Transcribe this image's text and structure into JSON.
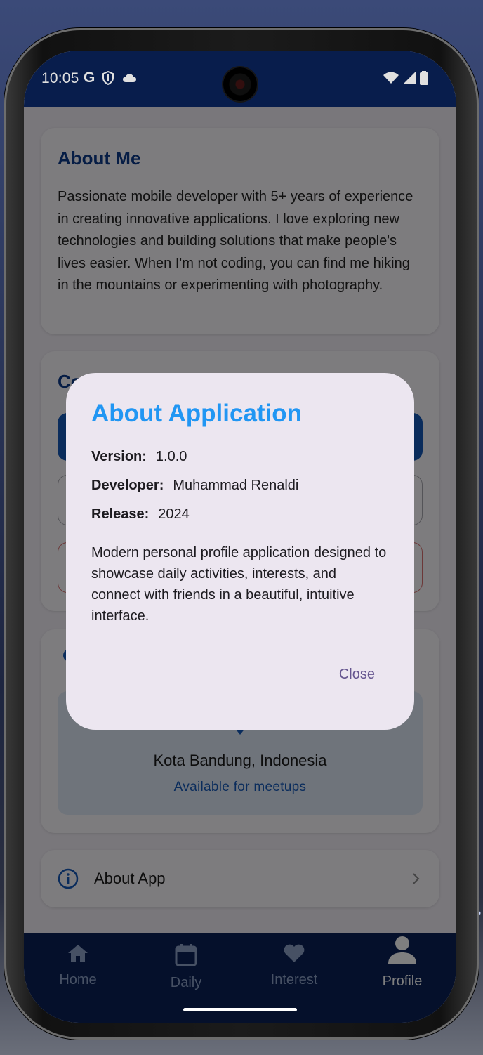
{
  "status_bar": {
    "time": "10:05",
    "left_icons": [
      "google-g-icon",
      "shield-icon",
      "cloud-icon"
    ],
    "right_icons": [
      "wifi-icon",
      "signal-icon",
      "battery-icon"
    ]
  },
  "about_me": {
    "title": "About Me",
    "text": "Passionate mobile developer with 5+ years of experience in creating innovative applications. I love exploring new technologies and building solutions that make people's lives easier. When I'm not coding, you can find me hiking in the mountains or experimenting with photography."
  },
  "contact": {
    "title": "Co"
  },
  "location": {
    "city": "Kota Bandung, Indonesia",
    "status": "Available for meetups"
  },
  "about_app_item": {
    "label": "About App",
    "icon": "info-icon"
  },
  "bottom_nav": {
    "items": [
      {
        "label": "Home",
        "icon": "home-icon"
      },
      {
        "label": "Daily",
        "icon": "calendar-icon"
      },
      {
        "label": "Interest",
        "icon": "heart-icon"
      },
      {
        "label": "Profile",
        "icon": "person-icon",
        "active": true
      }
    ]
  },
  "dialog": {
    "title": "About Application",
    "rows": [
      {
        "key": "Version:",
        "value": "1.0.0"
      },
      {
        "key": "Developer:",
        "value": "Muhammad Renaldi"
      },
      {
        "key": "Release:",
        "value": "2024"
      }
    ],
    "description": "Modern personal profile application designed to showcase daily activities, interests, and connect with friends in a beautiful, intuitive interface.",
    "close_label": "Close"
  },
  "colors": {
    "primary": "#0A2157",
    "accent_blue": "#1558B8",
    "dialog_title": "#2196F3",
    "dialog_bg": "#ECE6F0",
    "close_text": "#65558F"
  }
}
